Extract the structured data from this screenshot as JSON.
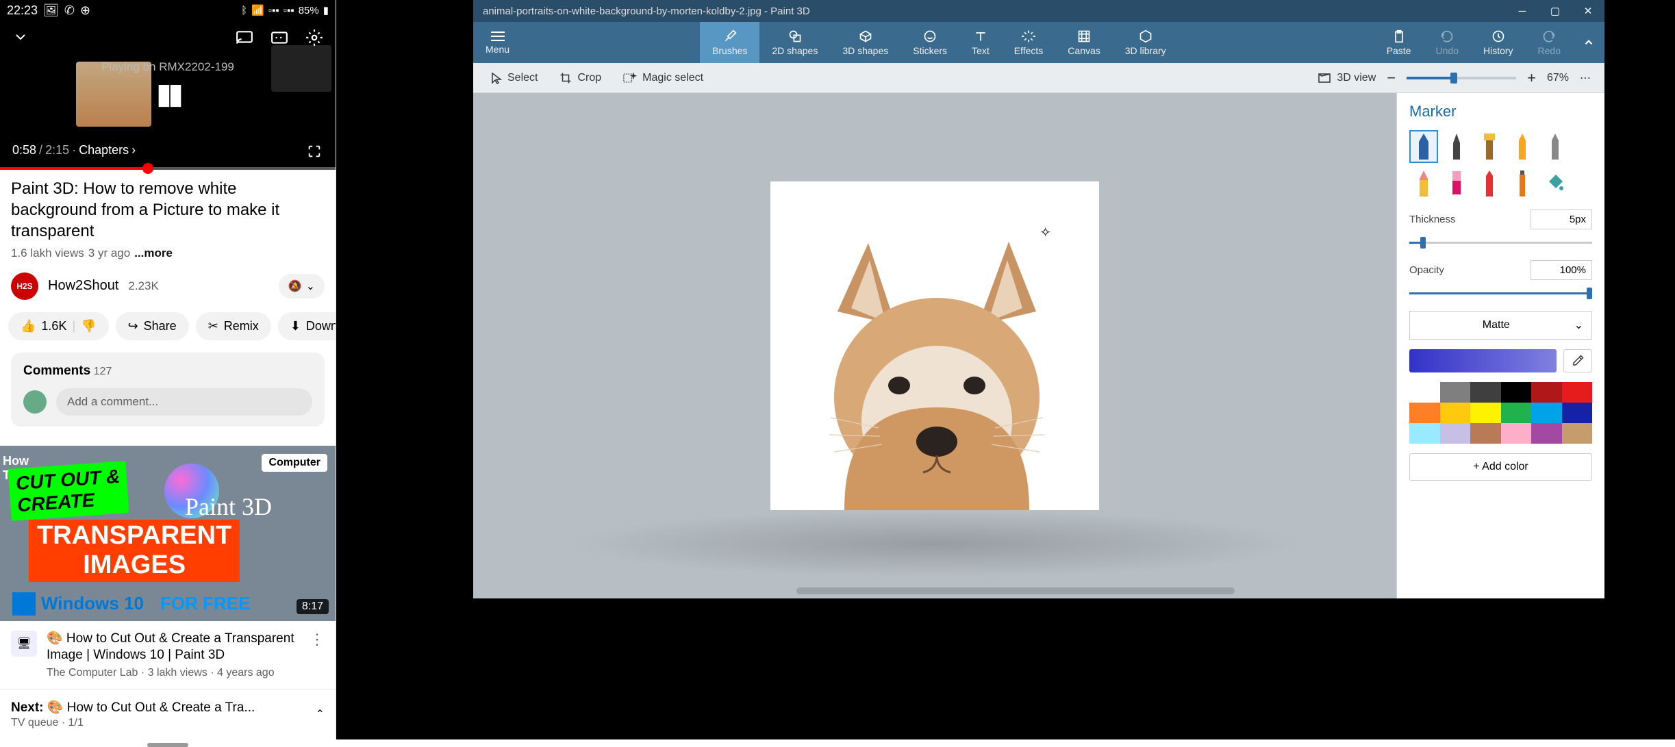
{
  "mobile": {
    "status": {
      "time": "22:23",
      "battery": "85%"
    },
    "player": {
      "casting": "Playing on RMX2202-199",
      "current": "0:58",
      "duration": "2:15",
      "chapters": "Chapters"
    },
    "video": {
      "title": "Paint 3D: How to remove white background from a Picture to make it transparent",
      "views": "1.6 lakh views",
      "age": "3 yr ago",
      "more": "...more"
    },
    "channel": {
      "avatar": "H2S",
      "name": "How2Shout",
      "subs": "2.23K"
    },
    "actions": {
      "likes": "1.6K",
      "share": "Share",
      "remix": "Remix",
      "download": "Downloa"
    },
    "comments": {
      "label": "Comments",
      "count": "127",
      "placeholder": "Add a comment..."
    },
    "related": {
      "howto": "How\nTo",
      "computer": "Computer",
      "green": "CUT OUT &\nCREATE",
      "p3d": "Paint 3D",
      "orange": "TRANSPARENT\nIMAGES",
      "win": "Windows 10",
      "free": "FOR FREE",
      "dur": "8:17",
      "title": "🎨 How to Cut Out & Create a Transparent Image |  Windows 10 | Paint 3D",
      "meta": "The Computer Lab · 3 lakh views · 4 years ago"
    },
    "upnext": {
      "label": "Next:",
      "title": "🎨 How to Cut Out & Create a Tra...",
      "queue": "TV queue · 1/1"
    }
  },
  "p3d": {
    "title": "animal-portraits-on-white-background-by-morten-koldby-2.jpg - Paint 3D",
    "ribbon": {
      "menu": "Menu",
      "brushes": "Brushes",
      "shapes2d": "2D shapes",
      "shapes3d": "3D shapes",
      "stickers": "Stickers",
      "text": "Text",
      "effects": "Effects",
      "canvas": "Canvas",
      "lib": "3D library",
      "paste": "Paste",
      "undo": "Undo",
      "history": "History",
      "redo": "Redo"
    },
    "toolbar": {
      "select": "Select",
      "crop": "Crop",
      "magic": "Magic select",
      "view3d": "3D view",
      "zoom": "67%"
    },
    "panel": {
      "title": "Marker",
      "thickness_label": "Thickness",
      "thickness": "5px",
      "opacity_label": "Opacity",
      "opacity": "100%",
      "finish": "Matte",
      "addcolor": "+  Add color",
      "palette": [
        "#ffffff",
        "#7f7f7f",
        "#3f3f3f",
        "#000000",
        "#b01718",
        "#e61b1b",
        "#ff7f27",
        "#ffc90e",
        "#fff200",
        "#22b14c",
        "#00a2e8",
        "#1522a6",
        "#99eaff",
        "#c8bfe7",
        "#b97a57",
        "#ffaec9",
        "#a349a4",
        "#c69c6d"
      ]
    }
  }
}
